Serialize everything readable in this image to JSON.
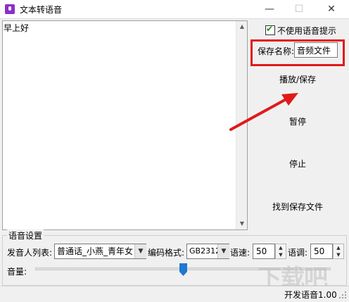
{
  "window": {
    "title": "文本转语音",
    "minimize_glyph": "—",
    "maximize_glyph": "☐",
    "close_glyph": "✕"
  },
  "text_area": {
    "content": "早上好"
  },
  "options": {
    "no_voice_prompt_label": "不使用语音提示",
    "no_voice_prompt_checked": true
  },
  "save_name": {
    "label": "保存名称:",
    "value": "音频文件"
  },
  "buttons": {
    "play_save": "播放/保存",
    "pause": "暂停",
    "stop": "停止",
    "find_saved_file": "找到保存文件"
  },
  "voice_settings": {
    "group_title": "语音设置",
    "speaker_list_label": "发音人列表:",
    "speaker_value": "普通话_小燕_青年女",
    "encoding_label": "编码格式:",
    "encoding_value": "GB2312",
    "speed_label": "语速:",
    "speed_value": "50",
    "pitch_label": "语调:",
    "pitch_value": "50",
    "volume_label": "音量:",
    "volume_level_fraction": 0.5
  },
  "status_bar": {
    "text": "开发语音1.00"
  },
  "colors": {
    "highlight_box": "#e01a1a",
    "annotation_arrow": "#e01a1a",
    "slider_thumb": "#1f78d1",
    "checkbox_mark": "#1a8c1a"
  },
  "icons": {
    "app": "microphone-icon",
    "checkbox": "checkmark-icon",
    "dropdown": "chevron-down-icon",
    "spin_up": "triangle-up-icon",
    "spin_down": "triangle-down-icon",
    "resize": "resize-grip-icon"
  },
  "watermark_text": "下载吧"
}
